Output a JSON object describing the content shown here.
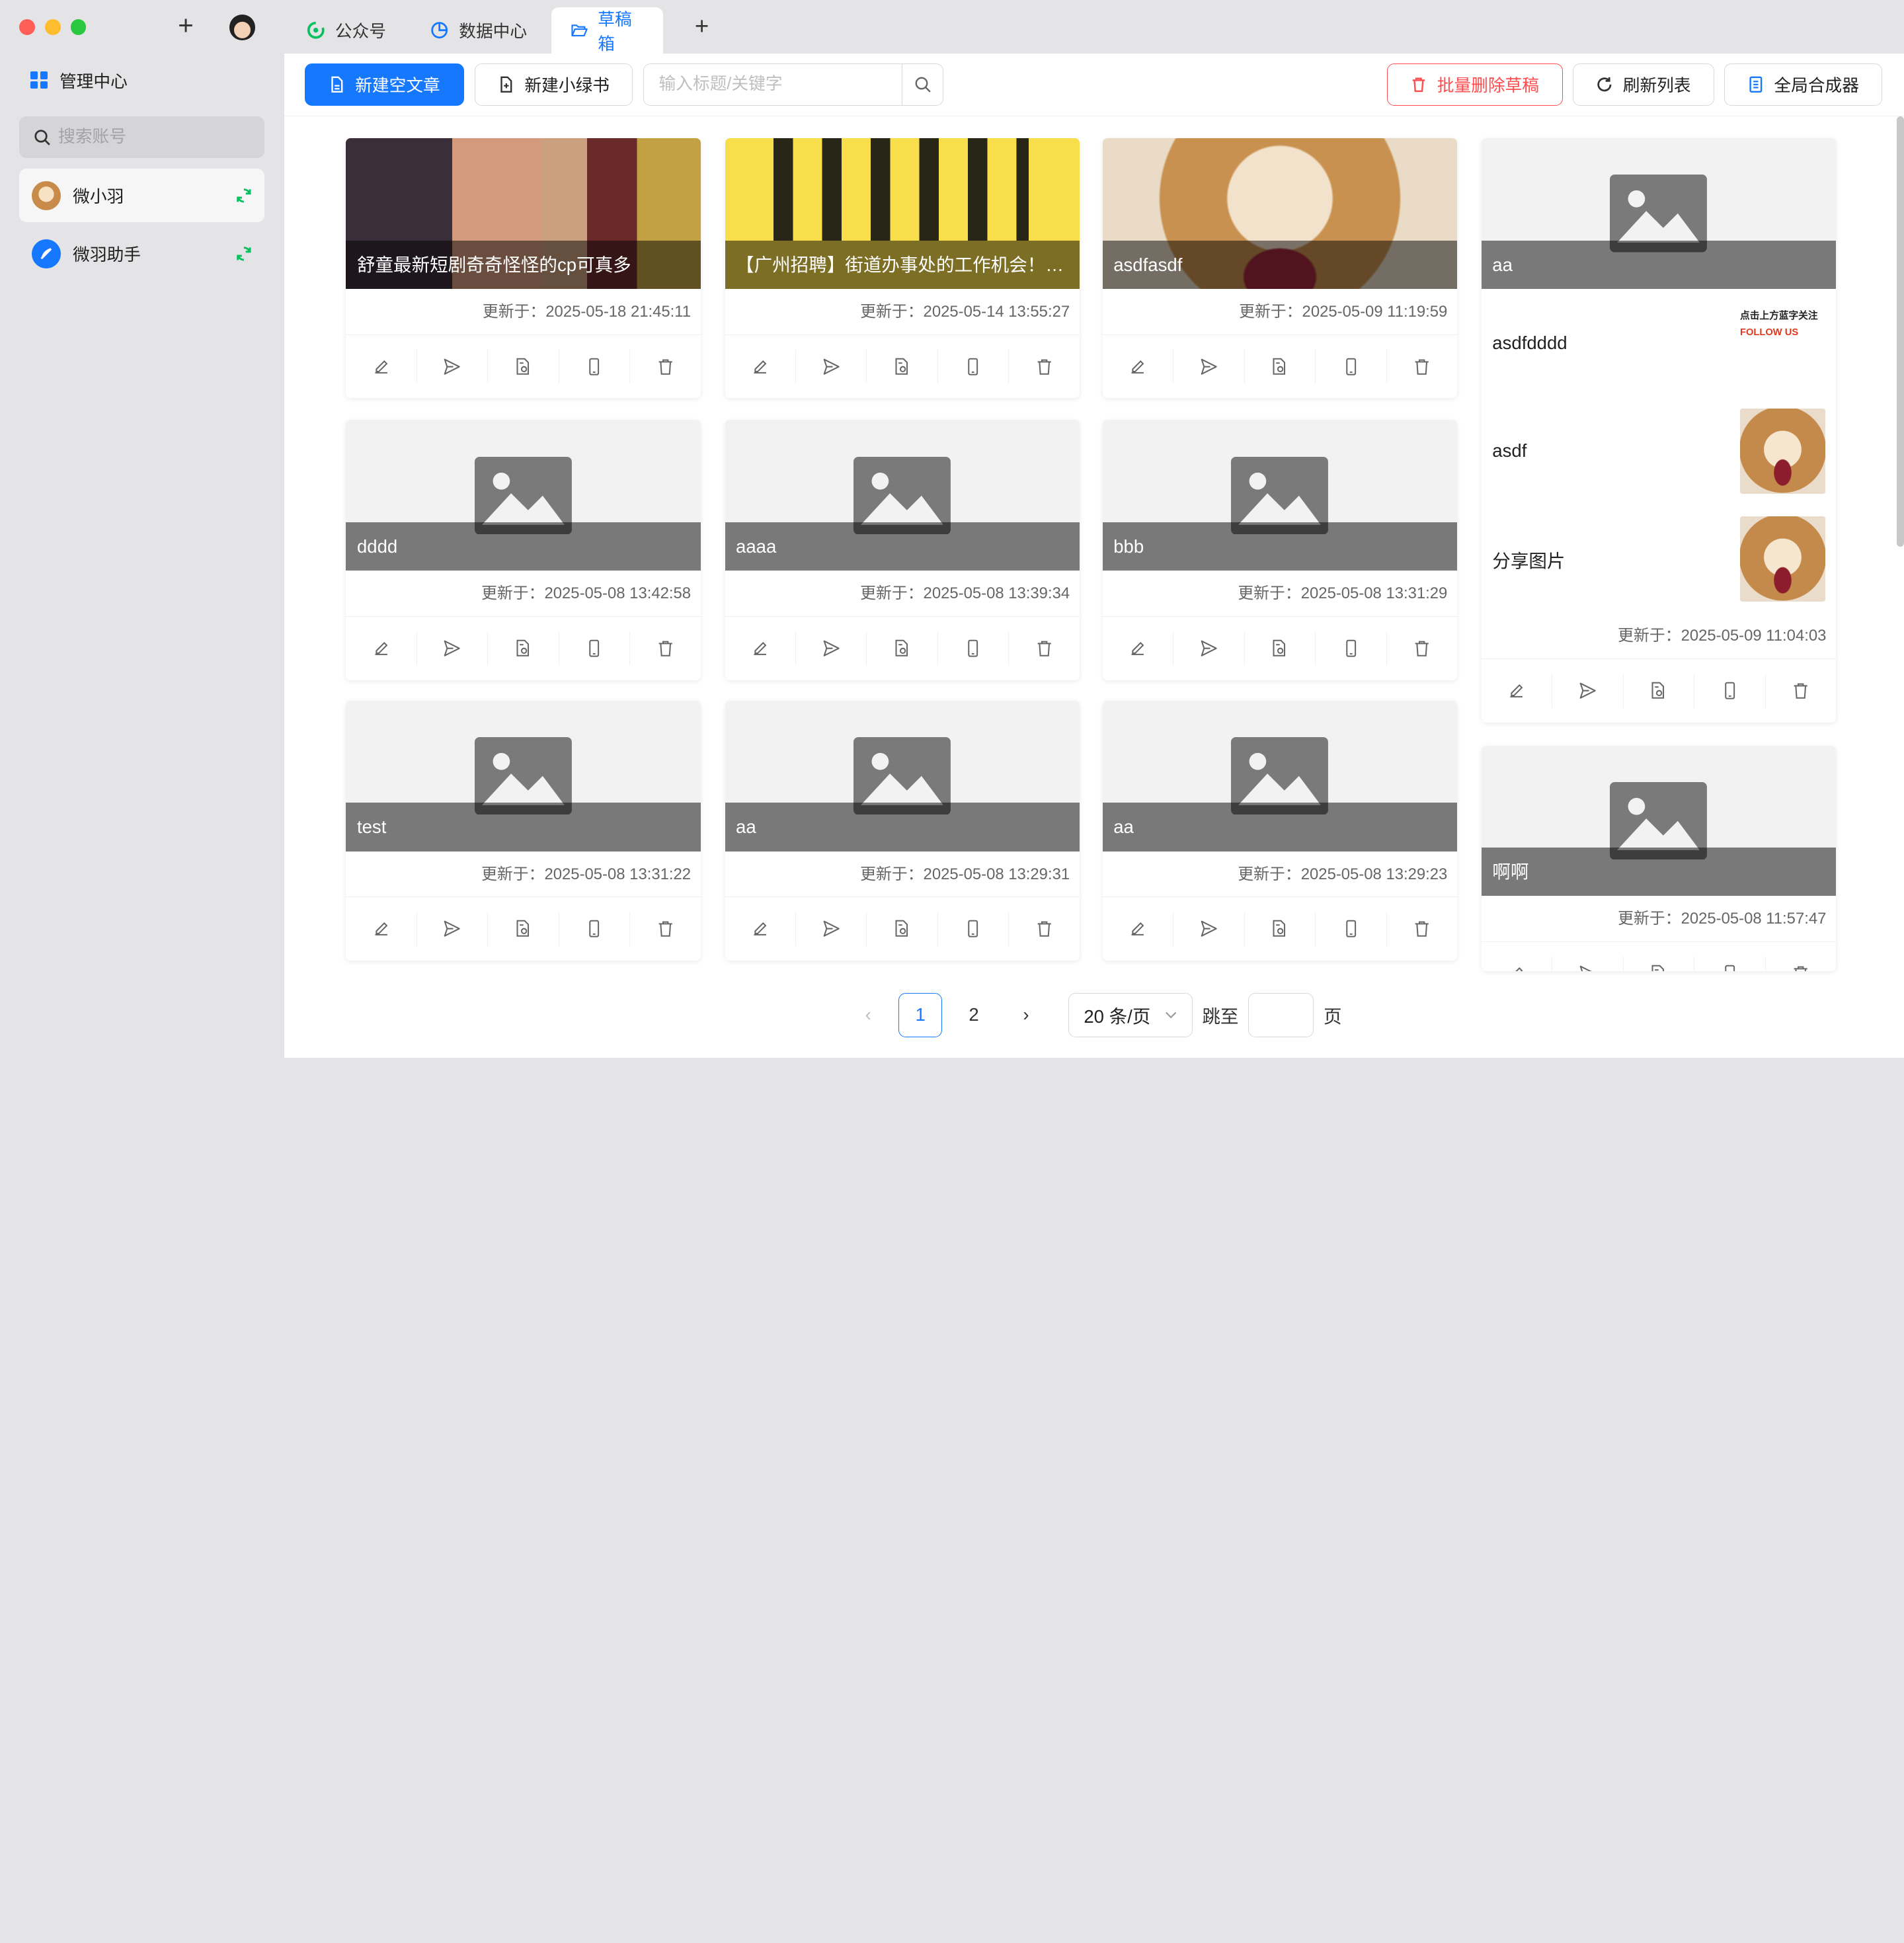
{
  "window": {
    "traffic_colors": [
      "#ff5f57",
      "#febc2e",
      "#28c840"
    ]
  },
  "sidebar": {
    "manage_label": "管理中心",
    "search_placeholder": "搜索账号",
    "accounts": [
      {
        "name": "微小羽",
        "active": true
      },
      {
        "name": "微羽助手",
        "active": false
      }
    ]
  },
  "tabs": [
    {
      "label": "公众号",
      "icon": "wechat-icon",
      "active": false
    },
    {
      "label": "数据中心",
      "icon": "pie-chart-icon",
      "active": false
    },
    {
      "label": "草稿箱",
      "icon": "folder-open-icon",
      "active": true
    }
  ],
  "toolbar": {
    "new_article": "新建空文章",
    "new_xhs": "新建小绿书",
    "search_placeholder": "输入标题/关键字",
    "batch_delete": "批量删除草稿",
    "refresh": "刷新列表",
    "synthesizer": "全局合成器"
  },
  "cards": [
    {
      "title": "舒童最新短剧奇奇怪怪的cp可真多",
      "updated": "更新于：2025-05-18 21:45:11",
      "cover": "photo"
    },
    {
      "title": "【广州招聘】街道办事处的工作机会！高...",
      "updated": "更新于：2025-05-14 13:55:27",
      "cover": "yellow"
    },
    {
      "title": "asdfasdf",
      "updated": "更新于：2025-05-09 11:19:59",
      "cover": "dog"
    },
    {
      "title": "dddd",
      "updated": "更新于：2025-05-08 13:42:58",
      "cover": "placeholder"
    },
    {
      "title": "aaaa",
      "updated": "更新于：2025-05-08 13:39:34",
      "cover": "placeholder"
    },
    {
      "title": "bbb",
      "updated": "更新于：2025-05-08 13:31:29",
      "cover": "placeholder"
    },
    {
      "title": "test",
      "updated": "更新于：2025-05-08 13:31:22",
      "cover": "placeholder"
    },
    {
      "title": "aa",
      "updated": "更新于：2025-05-08 13:29:31",
      "cover": "placeholder"
    },
    {
      "title": "aa",
      "updated": "更新于：2025-05-08 13:29:23",
      "cover": "placeholder"
    }
  ],
  "multi_card": {
    "title": "aa",
    "items": [
      {
        "title": "asdfdddd",
        "thumb_line1": "点击上方蓝字关注",
        "thumb_line2": "FOLLOW US"
      },
      {
        "title": "asdf"
      },
      {
        "title": "分享图片"
      }
    ],
    "updated": "更新于：2025-05-09 11:04:03"
  },
  "bottom_card": {
    "title": "啊啊",
    "updated": "更新于：2025-05-08 11:57:47"
  },
  "pagination": {
    "pages": [
      "1",
      "2"
    ],
    "current": "1",
    "page_size": "20 条/页",
    "jump_label": "跳至",
    "page_suffix": "页"
  },
  "colors": {
    "accent": "#1677ff",
    "danger": "#ff4d4f",
    "sync": "#07c160"
  }
}
